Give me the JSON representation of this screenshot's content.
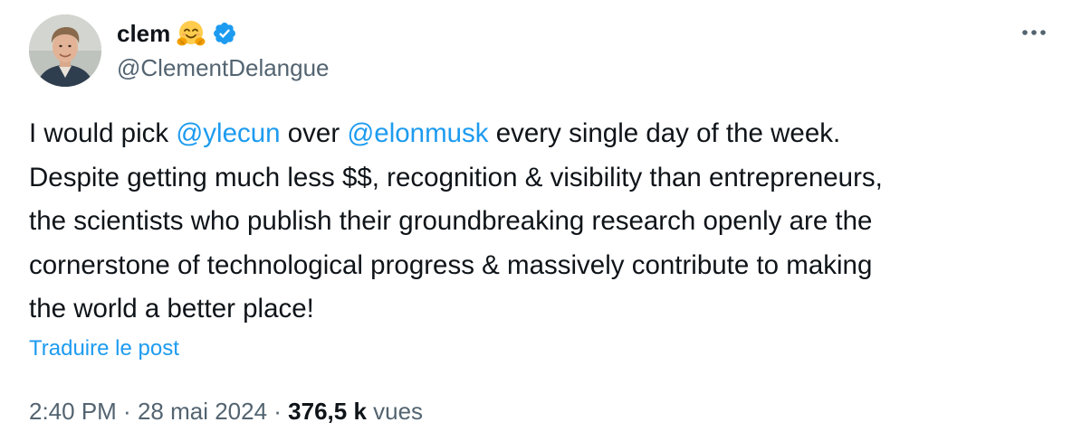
{
  "author": {
    "display_name": "clem",
    "handle": "@ClementDelangue",
    "emoji": "hugging-face-emoji",
    "badge": "verified-badge-icon"
  },
  "tweet": {
    "segments": [
      [
        {
          "text": "I would pick ",
          "type": "text"
        },
        {
          "text": "@ylecun",
          "type": "mention"
        },
        {
          "text": " over ",
          "type": "text"
        },
        {
          "text": "@elonmusk",
          "type": "mention"
        },
        {
          "text": " every single day of the week.",
          "type": "text"
        }
      ],
      [
        {
          "text": "Despite getting much less $$, recognition & visibility than entrepreneurs,",
          "type": "text"
        }
      ],
      [
        {
          "text": "the scientists who publish their groundbreaking research openly are the",
          "type": "text"
        }
      ],
      [
        {
          "text": "cornerstone of technological progress & massively contribute to making",
          "type": "text"
        }
      ],
      [
        {
          "text": "the world a better place!",
          "type": "text"
        }
      ]
    ],
    "translate_label": "Traduire le post"
  },
  "meta": {
    "time": "2:40 PM",
    "separator": " · ",
    "date": "28 mai 2024",
    "views_count": "376,5 k",
    "views_label": " vues"
  },
  "colors": {
    "link": "#1d9bf0",
    "text": "#0f1419",
    "secondary": "#536471",
    "verified": "#1d9bf0"
  }
}
